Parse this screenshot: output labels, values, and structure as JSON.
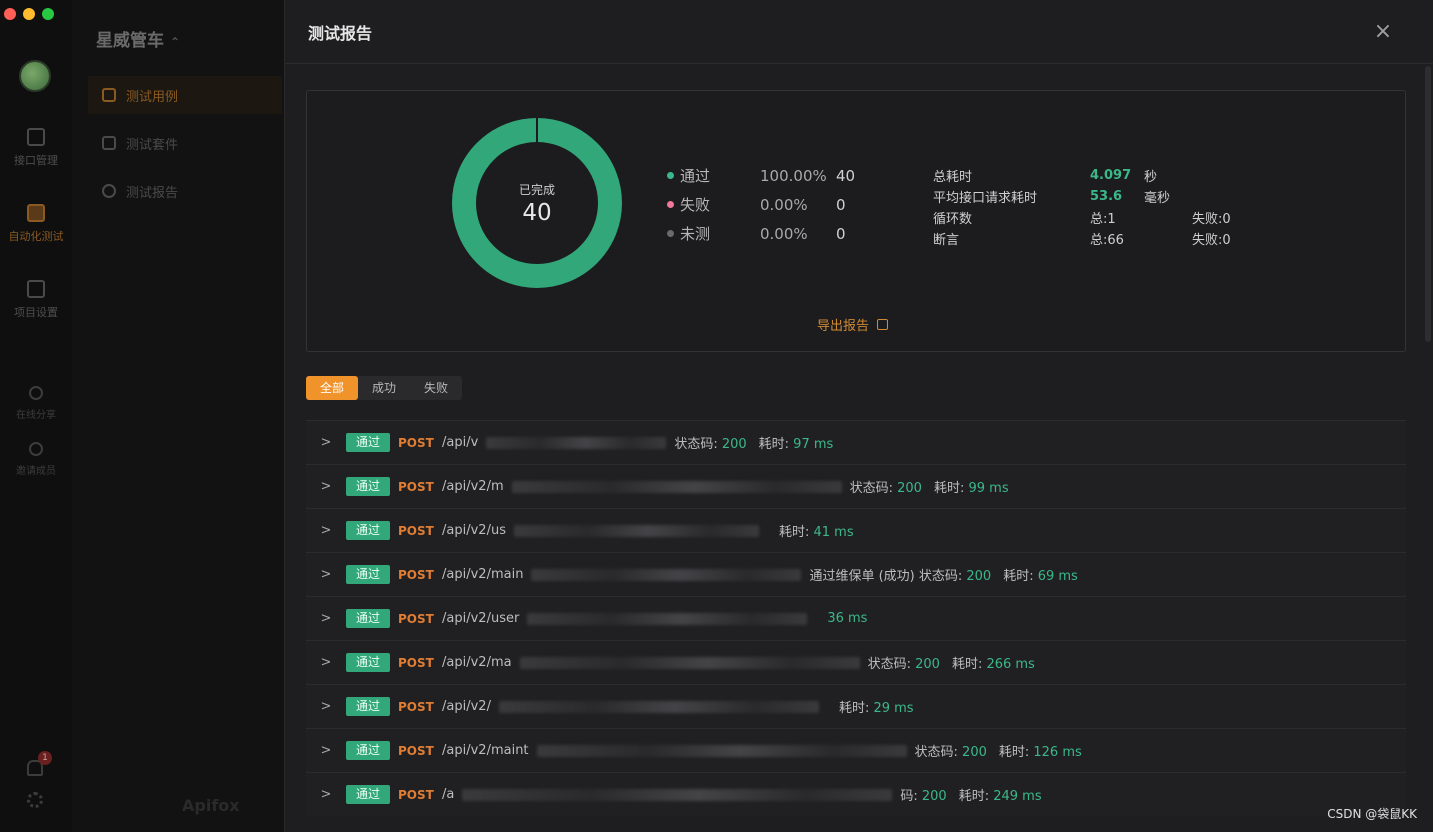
{
  "project": {
    "name": "星威管车",
    "switch_icon": "chevron-updown-icon"
  },
  "rail": {
    "items": [
      {
        "label": "接口管理",
        "icon": "api-icon"
      },
      {
        "label": "自动化测试",
        "icon": "automation-icon"
      },
      {
        "label": "项目设置",
        "icon": "settings-icon"
      },
      {
        "label": "在线分享",
        "icon": "share-icon"
      },
      {
        "label": "邀请成员",
        "icon": "invite-icon"
      }
    ],
    "notification_count": "1"
  },
  "sidebar": {
    "items": [
      {
        "label": "测试用例",
        "icon": "test-case-icon"
      },
      {
        "label": "测试套件",
        "icon": "test-suite-icon"
      },
      {
        "label": "测试报告",
        "icon": "report-icon"
      }
    ],
    "brand": "Apifox"
  },
  "panel": {
    "title": "测试报告",
    "close_label": "×"
  },
  "summary": {
    "done_label": "已完成",
    "done_value": "40",
    "legend": [
      {
        "name": "通过",
        "pct": "100.00%",
        "count": "40",
        "color": "#3bb889"
      },
      {
        "name": "失败",
        "pct": "0.00%",
        "count": "0",
        "color": "#f0789a"
      },
      {
        "name": "未测",
        "pct": "0.00%",
        "count": "0",
        "color": "#6a6a6a"
      }
    ],
    "stats": {
      "total_time_label": "总耗时",
      "total_time_value": "4.097",
      "total_time_unit": "秒",
      "avg_label": "平均接口请求耗时",
      "avg_value": "53.6",
      "avg_unit": "毫秒",
      "loop_label": "循环数",
      "loop_total": "总:1",
      "loop_fail": "失败:0",
      "assert_label": "断言",
      "assert_total": "总:66",
      "assert_fail": "失败:0"
    },
    "export_label": "导出报告"
  },
  "filters": [
    "全部",
    "成功",
    "失败"
  ],
  "results": [
    {
      "status": "通过",
      "method": "POST",
      "path": "/api/v",
      "tail": "状态码: ",
      "code": "200",
      "time_label": "耗时: ",
      "time": "97 ms",
      "blur": 180
    },
    {
      "status": "通过",
      "method": "POST",
      "path": "/api/v2/m",
      "tail": "状态码: ",
      "code": "200",
      "time_label": "耗时: ",
      "time": "99 ms",
      "blur": 330
    },
    {
      "status": "通过",
      "method": "POST",
      "path": "/api/v2/us",
      "tail": "",
      "code": "",
      "time_label": "耗时: ",
      "time": "41 ms",
      "blur": 245
    },
    {
      "status": "通过",
      "method": "POST",
      "path": "/api/v2/main",
      "tail": "通过维保单 (成功)  状态码: ",
      "code": "200",
      "time_label": "耗时: ",
      "time": "69 ms",
      "blur": 270
    },
    {
      "status": "通过",
      "method": "POST",
      "path": "/api/v2/user",
      "tail": "",
      "code": "",
      "time_label": "",
      "time": "36 ms",
      "blur": 280
    },
    {
      "status": "通过",
      "method": "POST",
      "path": "/api/v2/ma",
      "tail": "状态码: ",
      "code": "200",
      "time_label": "耗时: ",
      "time": "266 ms",
      "blur": 340
    },
    {
      "status": "通过",
      "method": "POST",
      "path": "/api/v2/",
      "tail": "",
      "code": "",
      "time_label": "耗时: ",
      "time": "29 ms",
      "blur": 320
    },
    {
      "status": "通过",
      "method": "POST",
      "path": "/api/v2/maint",
      "tail": "状态码: ",
      "code": "200",
      "time_label": "耗时: ",
      "time": "126 ms",
      "blur": 370
    },
    {
      "status": "通过",
      "method": "POST",
      "path": "/a",
      "tail": "码: ",
      "code": "200",
      "time_label": "耗时: ",
      "time": "249 ms",
      "blur": 430
    }
  ],
  "watermark": "CSDN @袋鼠KK"
}
